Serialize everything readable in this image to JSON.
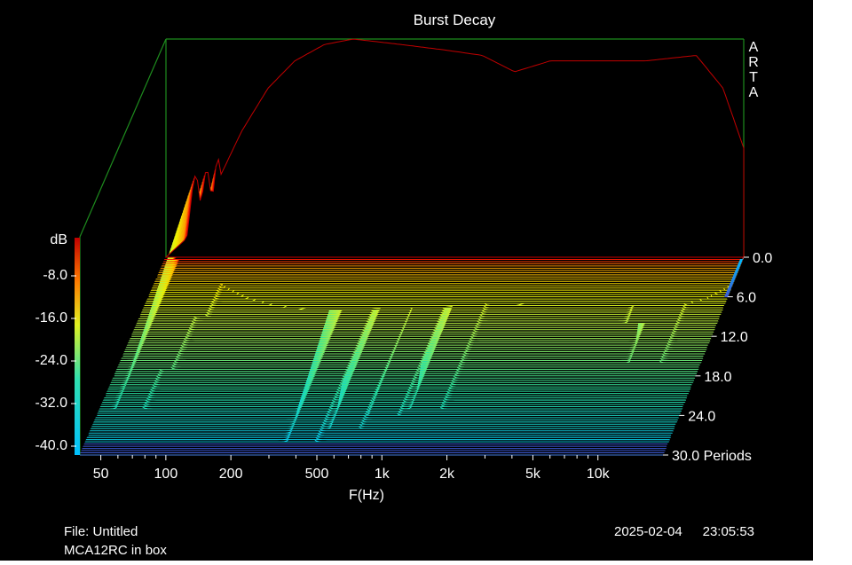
{
  "chart_data": {
    "type": "waterfall",
    "title": "Burst Decay",
    "xlabel": "F(Hz)",
    "x_scale": "log",
    "xlim": [
      40,
      20000
    ],
    "x_ticks": [
      {
        "value": 50,
        "label": "50"
      },
      {
        "value": 100,
        "label": "100"
      },
      {
        "value": 200,
        "label": "200"
      },
      {
        "value": 500,
        "label": "500"
      },
      {
        "value": 1000,
        "label": "1k"
      },
      {
        "value": 2000,
        "label": "2k"
      },
      {
        "value": 5000,
        "label": "5k"
      },
      {
        "value": 10000,
        "label": "10k"
      }
    ],
    "zlabel": "dB",
    "zlim": [
      -40,
      0
    ],
    "z_ticks": [
      "-8.0",
      "-16.0",
      "-24.0",
      "-32.0",
      "-40.0"
    ],
    "depth_axis_label": "Periods",
    "depth_ticks": [
      "0.0",
      "6.0",
      "12.0",
      "18.0",
      "24.0",
      "30.0 Periods"
    ],
    "depth_range": [
      0,
      30
    ],
    "brand": "ARTA",
    "first_slice_db": [
      {
        "f": 40,
        "db": -40
      },
      {
        "f": 55,
        "db": -35
      },
      {
        "f": 70,
        "db": -26
      },
      {
        "f": 90,
        "db": -17
      },
      {
        "f": 120,
        "db": -9
      },
      {
        "f": 160,
        "db": -4
      },
      {
        "f": 220,
        "db": -1
      },
      {
        "f": 300,
        "db": 0
      },
      {
        "f": 500,
        "db": -1
      },
      {
        "f": 800,
        "db": -2
      },
      {
        "f": 1200,
        "db": -3
      },
      {
        "f": 1700,
        "db": -6
      },
      {
        "f": 2500,
        "db": -4
      },
      {
        "f": 4000,
        "db": -4
      },
      {
        "f": 7000,
        "db": -4
      },
      {
        "f": 12000,
        "db": -3
      },
      {
        "f": 16000,
        "db": -9
      },
      {
        "f": 20000,
        "db": -20
      }
    ],
    "resonance_ridges": [
      {
        "f": 70,
        "peak_db": -22,
        "end_period": 9
      },
      {
        "f": 62,
        "peak_db": -24,
        "end_period": 17
      },
      {
        "f": 55,
        "peak_db": -25,
        "end_period": 23
      },
      {
        "f": 400,
        "peak_db": -21,
        "end_period": 28
      },
      {
        "f": 600,
        "peak_db": -16,
        "end_period": 26
      },
      {
        "f": 850,
        "peak_db": -15,
        "end_period": 24
      },
      {
        "f": 1300,
        "peak_db": -10,
        "end_period": 23
      },
      {
        "f": 9000,
        "peak_db": -6,
        "end_period": 10
      },
      {
        "f": 11000,
        "peak_db": -5,
        "end_period": 16
      }
    ],
    "colors": {
      "background": "#000000",
      "frame": "#1e8c1e",
      "floor": "#3c5ad6",
      "scale": [
        "#00c0ff",
        "#28e0a0",
        "#b8f040",
        "#f0f000",
        "#ff9000",
        "#ff2000",
        "#c00000"
      ]
    }
  },
  "footer": {
    "file": "File: Untitled",
    "note": "MCA12RC in box",
    "date": "2025-02-04",
    "time": "23:05:53"
  }
}
